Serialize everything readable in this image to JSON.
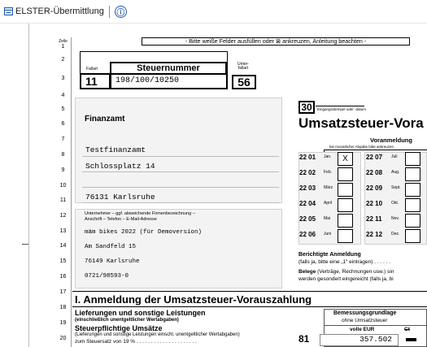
{
  "app": {
    "title": "ELSTER-Übermittlung",
    "info_symbol": "ⓘ"
  },
  "form": {
    "zeile_label": "Zeile",
    "lines": [
      "1",
      "2",
      "3",
      "4",
      "5",
      "6",
      "7",
      "8",
      "9",
      "10",
      "11",
      "12",
      "13",
      "14",
      "15",
      "16",
      "17",
      "18",
      "19",
      "20"
    ],
    "header_instruction": "- Bitte weiße Felder ausfüllen oder ⊠ ankreuzen, Anleitung beachten -",
    "fallart_label": "Fallart",
    "fallart_value": "11",
    "steuernummer_label": "Steuernummer",
    "steuernummer_value": "198/100/10250",
    "unterfallart_label": "Unter-fallart",
    "unterfallart_value": "56",
    "finanzamt_label": "Finanzamt",
    "finanzamt_name": "Testfinanzamt",
    "finanzamt_street": "Schlossplatz 14",
    "finanzamt_city": "76131 Karlsruhe",
    "company_label_line1": "Unternehmer – ggf. abweichende Firmenbezeichnung –",
    "company_label_line2": "Anschrift – Telefon – E-Mail-Adresse",
    "company_name": "mäm bikes 2022 (für Demoversion)",
    "company_street": "Am Sandfeld 15",
    "company_city": "76149 Karlsruhe",
    "company_phone": "0721/98593-0",
    "year_code": "30",
    "eingangsstempel_label": "Eingangsstempel oder -datum",
    "form_title": "Umsatzsteuer-Vora",
    "voranmeldung_label": "Voranmeldung",
    "monthly_hint": "bei monatlicher Abgabe bitte ankreuzen",
    "months": [
      {
        "code": "22 01",
        "name": "Jan.",
        "mark": "X"
      },
      {
        "code": "22 02",
        "name": "Feb.",
        "mark": ""
      },
      {
        "code": "22 03",
        "name": "März",
        "mark": ""
      },
      {
        "code": "22 04",
        "name": "April",
        "mark": ""
      },
      {
        "code": "22 05",
        "name": "Mai",
        "mark": ""
      },
      {
        "code": "22 06",
        "name": "Juni",
        "mark": ""
      },
      {
        "code": "22 07",
        "name": "Juli",
        "mark": ""
      },
      {
        "code": "22 08",
        "name": "Aug.",
        "mark": ""
      },
      {
        "code": "22 09",
        "name": "Sept.",
        "mark": ""
      },
      {
        "code": "22 10",
        "name": "Okt.",
        "mark": ""
      },
      {
        "code": "22 11",
        "name": "Nov.",
        "mark": ""
      },
      {
        "code": "22 12",
        "name": "Dez.",
        "mark": ""
      }
    ],
    "berichtigte_title": "Berichtigte Anmeldung",
    "berichtigte_text": "(falls ja, bitte eine „1“ eintragen) . . . . . .",
    "belege_bold": "Belege",
    "belege_text": " (Verträge, Rechnungen usw.) sin",
    "belege_text2": "werden gesondert eingereicht (falls ja, bi",
    "section_title": "I. Anmeldung der Umsatzsteuer-Vorauszahlung",
    "lieferungen_title": "Lieferungen und sonstige Leistungen",
    "lieferungen_sub": "(einschließlich unentgeltlicher Wertabgaben)",
    "steuerpflichtige_title": "Steuerpflichtige Umsätze",
    "steuerpflichtige_sub": "(Lieferungen und sonstige Leistungen einschl. unentgeltlicher Wertabgaben)",
    "steuersatz_text": "zum Steuersatz von 19 % . . . . . . . . . . . . . . . . . . . . .",
    "bemessung_title": "Bemessungsgrundlage",
    "bemessung_sub": "ohne Umsatzsteuer",
    "volle_eur": "volle EUR",
    "ct_label": "Ct",
    "kz_81": "81",
    "kz_81_value": "357.502"
  }
}
